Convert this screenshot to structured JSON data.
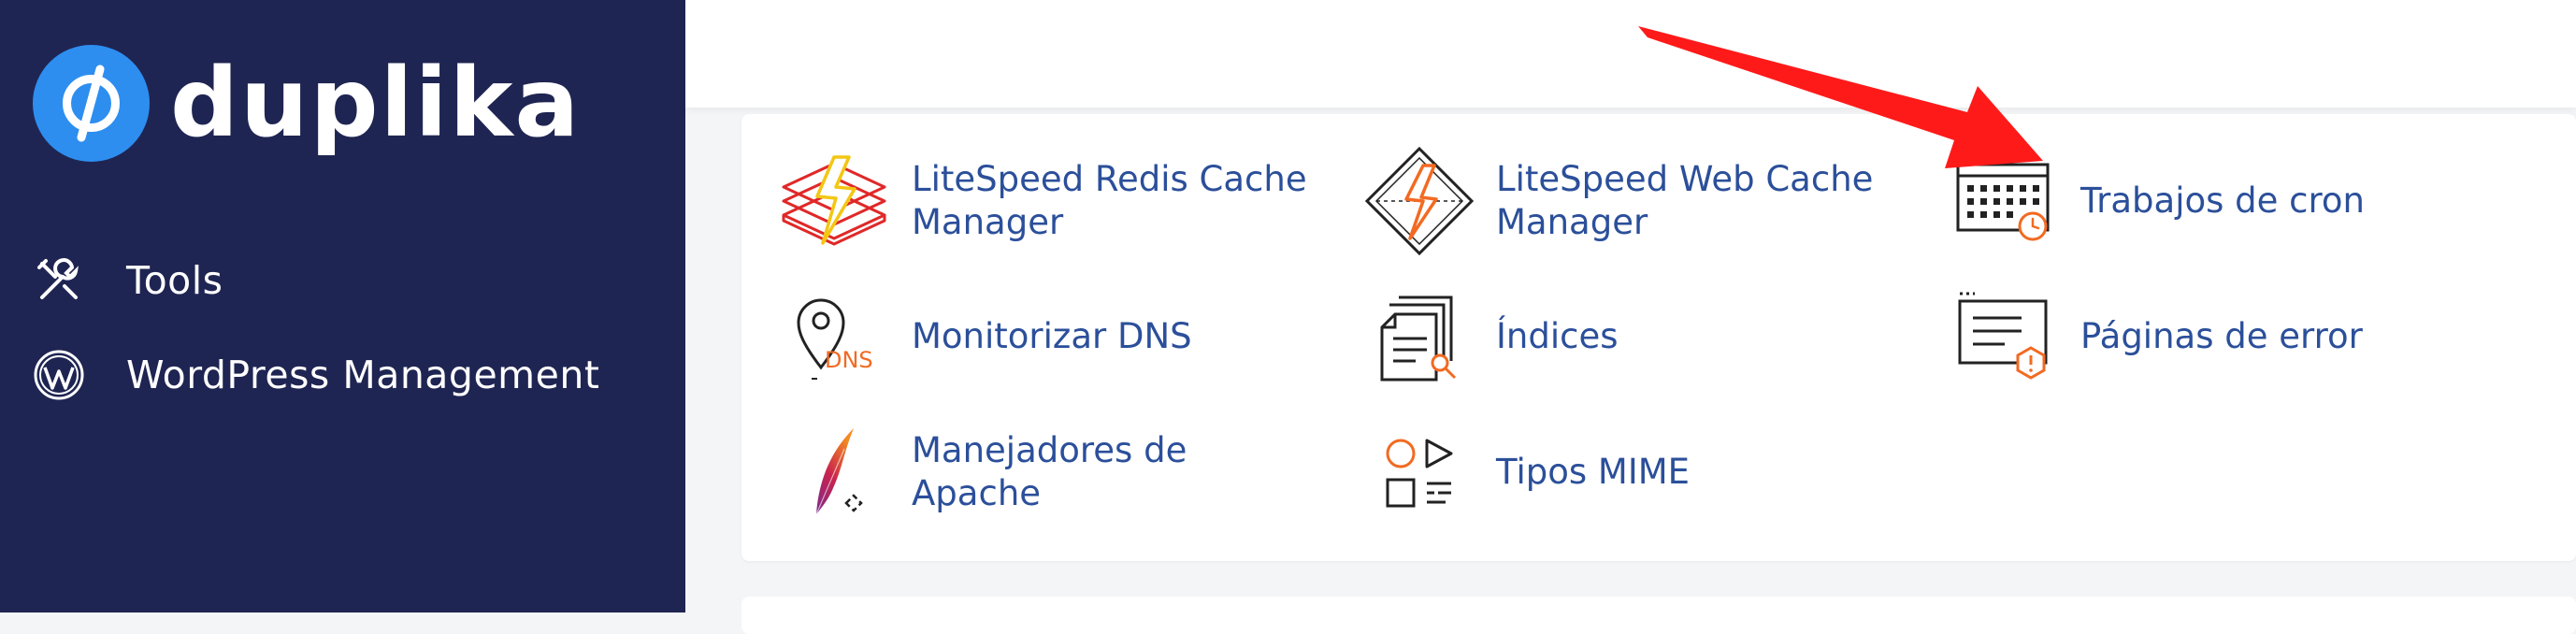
{
  "brand": {
    "name": "duplika"
  },
  "sidebar": {
    "items": [
      {
        "label": "Tools",
        "icon": "tools-icon"
      },
      {
        "label": "WordPress Management",
        "icon": "wordpress-icon"
      }
    ]
  },
  "tools": [
    {
      "label": "LiteSpeed Redis Cache Manager",
      "icon": "litespeed-redis-icon"
    },
    {
      "label": "LiteSpeed Web Cache Manager",
      "icon": "litespeed-web-cache-icon"
    },
    {
      "label": "Trabajos de cron",
      "icon": "cron-calendar-icon"
    },
    {
      "label": "Monitorizar DNS",
      "icon": "dns-monitor-icon"
    },
    {
      "label": "Índices",
      "icon": "indexes-icon"
    },
    {
      "label": "Páginas de error",
      "icon": "error-pages-icon"
    },
    {
      "label": "Manejadores de Apache",
      "icon": "apache-feather-icon"
    },
    {
      "label": "Tipos MIME",
      "icon": "mime-types-icon"
    }
  ],
  "colors": {
    "sidebar_bg": "#1f2552",
    "brand_blue": "#2d8ef0",
    "link": "#2b4f9a",
    "accent_orange": "#f26a22",
    "annotation_arrow": "#ff1a1a"
  }
}
